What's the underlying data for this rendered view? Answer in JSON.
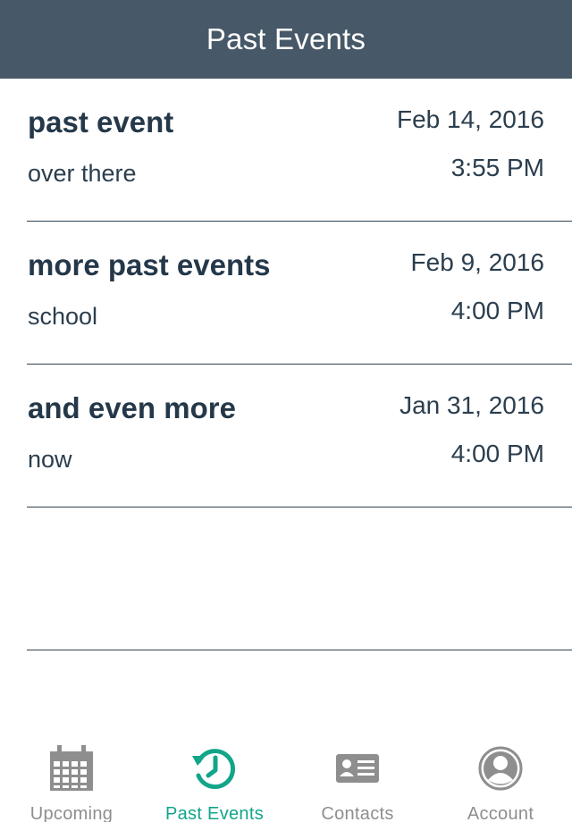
{
  "header": {
    "title": "Past Events"
  },
  "events": [
    {
      "title": "past event",
      "location": "over there",
      "date": "Feb 14, 2016",
      "time": "3:55 PM"
    },
    {
      "title": "more past events",
      "location": "school",
      "date": "Feb 9, 2016",
      "time": "4:00 PM"
    },
    {
      "title": "and even more",
      "location": "now",
      "date": "Jan 31, 2016",
      "time": "4:00 PM"
    }
  ],
  "tabs": [
    {
      "label": "Upcoming",
      "icon": "calendar-icon",
      "active": false
    },
    {
      "label": "Past Events",
      "icon": "history-clock-icon",
      "active": true
    },
    {
      "label": "Contacts",
      "icon": "contact-card-icon",
      "active": false
    },
    {
      "label": "Account",
      "icon": "user-circle-icon",
      "active": false
    }
  ],
  "colors": {
    "navbar": "#475968",
    "text": "#24384a",
    "active_tab": "#12a58a",
    "inactive_tab": "#8e8e8e"
  }
}
